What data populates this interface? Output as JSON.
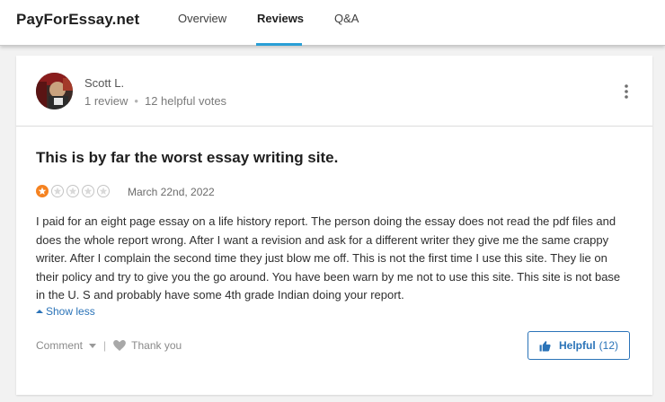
{
  "header": {
    "brand": "PayForEssay.net",
    "tabs": [
      {
        "label": "Overview"
      },
      {
        "label": "Reviews"
      },
      {
        "label": "Q&A"
      }
    ],
    "accent": "#2a9fd6"
  },
  "review": {
    "reviewer": {
      "name": "Scott L.",
      "review_count": "1 review",
      "helpful_votes": "12 helpful votes"
    },
    "more_icon": "more-vertical-icon",
    "title": "This is by far the worst essay writing site.",
    "rating": 1,
    "rating_max": 5,
    "star_color": "#f58220",
    "date": "March 22nd, 2022",
    "body": "I paid for an eight page essay on a life history report. The person doing the essay does not read the pdf files and does the whole report wrong. After I want a revision and ask for a different writer they give me the same crappy writer. After I complain the second time they just blow me off. This is not the first time I use this site. They lie on their policy and try to give you the go around. You have been warn by me not to use this site. This site is not base in the U. S and probably have some 4th grade Indian doing your report.",
    "show_less": "Show less",
    "actions": {
      "comment": "Comment",
      "separator": "|",
      "thank_you": "Thank you",
      "helpful_label": "Helpful",
      "helpful_count": "(12)"
    },
    "link_color": "#2a73b8"
  }
}
